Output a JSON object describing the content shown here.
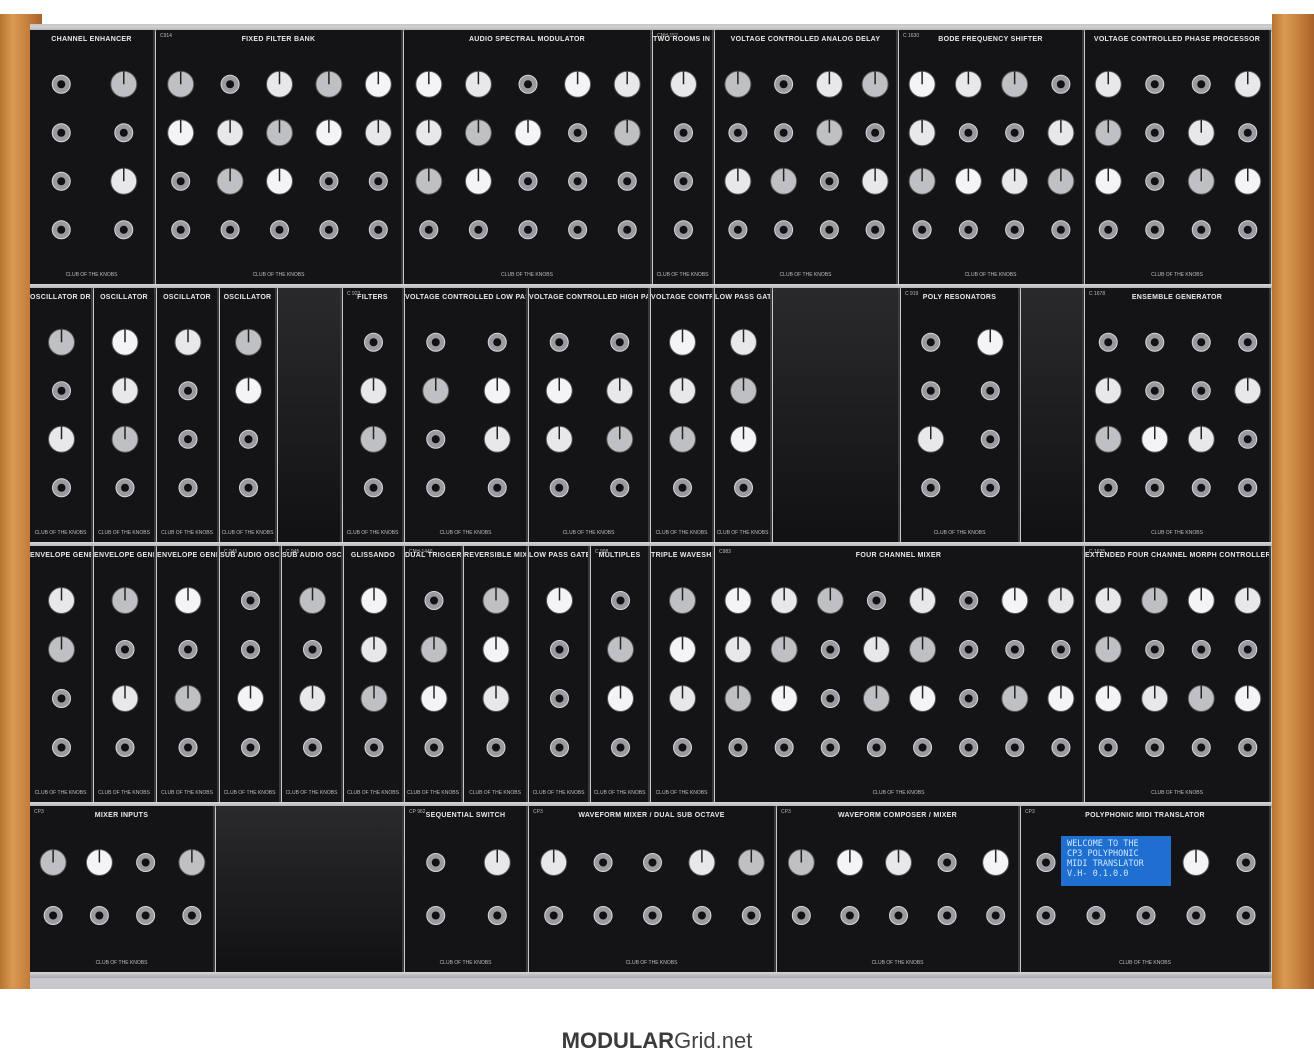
{
  "footer": {
    "brand_bold": "MODULAR",
    "brand_light": "Grid.net"
  },
  "brand_line": "CLUB OF THE KNOBS",
  "lcd_lines": [
    "WELCOME TO THE",
    "CP3 POLYPHONIC",
    "MIDI TRANSLATOR",
    "V.H- 0.1.0.0"
  ],
  "modules": [
    {
      "title": "CHANNEL ENHANCER",
      "code": ""
    },
    {
      "title": "FIXED FILTER BANK",
      "code": "C914"
    },
    {
      "title": "AUDIO SPECTRAL MODULATOR",
      "code": ""
    },
    {
      "title": "TWO ROOMS IN ONE",
      "code": "CNH-152"
    },
    {
      "title": "VOLTAGE CONTROLLED ANALOG DELAY",
      "code": ""
    },
    {
      "title": "BODE FREQUENCY SHIFTER",
      "code": "C 1630"
    },
    {
      "title": "VOLTAGE CONTROLLED PHASE PROCESSOR",
      "code": ""
    },
    {
      "title": "OSCILLATOR DRIVER",
      "code": ""
    },
    {
      "title": "OSCILLATOR",
      "code": ""
    },
    {
      "title": "OSCILLATOR",
      "code": ""
    },
    {
      "title": "OSCILLATOR",
      "code": ""
    },
    {
      "title": "FILTERS",
      "code": "C 923"
    },
    {
      "title": "VOLTAGE CONTROLLED LOW PASS FILTER",
      "code": ""
    },
    {
      "title": "VOLTAGE CONTROLLED HIGH PASS FILTER",
      "code": ""
    },
    {
      "title": "VOLTAGE CONTROLLED AMPLIFIER",
      "code": ""
    },
    {
      "title": "LOW PASS GATE",
      "code": ""
    },
    {
      "title": "POLY RESONATORS",
      "code": "C 919"
    },
    {
      "title": "ENSEMBLE GENERATOR",
      "code": "C 1678"
    },
    {
      "title": "ENVELOPE GENERATOR",
      "code": ""
    },
    {
      "title": "ENVELOPE GENERATOR",
      "code": ""
    },
    {
      "title": "ENVELOPE GENERATOR",
      "code": ""
    },
    {
      "title": "SUB AUDIO OSCILLATOR",
      "code": "C 945"
    },
    {
      "title": "SUB AUDIO OSCILLATOR",
      "code": "C 945"
    },
    {
      "title": "GLISSANDO",
      "code": ""
    },
    {
      "title": "DUAL TRIGGER DELAY",
      "code": "CNH-1446"
    },
    {
      "title": "REVERSIBLE MIXER",
      "code": ""
    },
    {
      "title": "LOW PASS GATE",
      "code": ""
    },
    {
      "title": "MULTIPLES",
      "code": "C 908"
    },
    {
      "title": "TRIPLE WAVESHAPER",
      "code": ""
    },
    {
      "title": "FOUR CHANNEL MIXER",
      "code": "C983"
    },
    {
      "title": "EXTENDED FOUR CHANNEL MORPH CONTROLLER",
      "code": "C 1635"
    },
    {
      "title": "MIXER INPUTS",
      "code": "CP3"
    },
    {
      "title": "SEQUENTIAL SWITCH",
      "code": "CP 962"
    },
    {
      "title": "WAVEFORM MIXER / DUAL SUB OCTAVE",
      "code": "CP3"
    },
    {
      "title": "WAVEFORM COMPOSER / MIXER",
      "code": "CP3"
    },
    {
      "title": "POLYPHONIC MIDI TRANSLATOR",
      "code": "CP3"
    }
  ]
}
